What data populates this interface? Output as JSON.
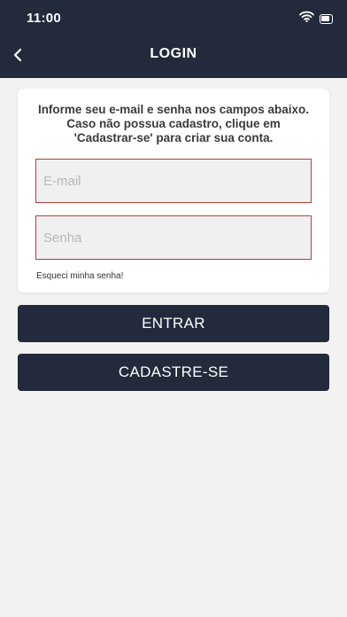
{
  "status_bar": {
    "time": "11:00",
    "icons": [
      "wifi-icon",
      "battery-icon"
    ]
  },
  "header": {
    "title": "LOGIN",
    "back_icon": "chevron-left-icon"
  },
  "form": {
    "info_line1": "Informe seu e-mail e senha nos campos abaixo.",
    "info_line2": "Caso não possua cadastro, clique em",
    "info_line3": "'Cadastrar-se' para criar sua conta.",
    "email_placeholder": "E-mail",
    "email_value": "",
    "password_placeholder": "Senha",
    "password_value": "",
    "forgot_password": "Esqueci minha senha!"
  },
  "actions": {
    "login_label": "ENTRAR",
    "signup_label": "CADASTRE-SE"
  },
  "colors": {
    "header_bg": "#222a3c",
    "page_bg": "#f2f2f2",
    "field_border": "#b2413a",
    "button_bg": "#222a3c"
  }
}
